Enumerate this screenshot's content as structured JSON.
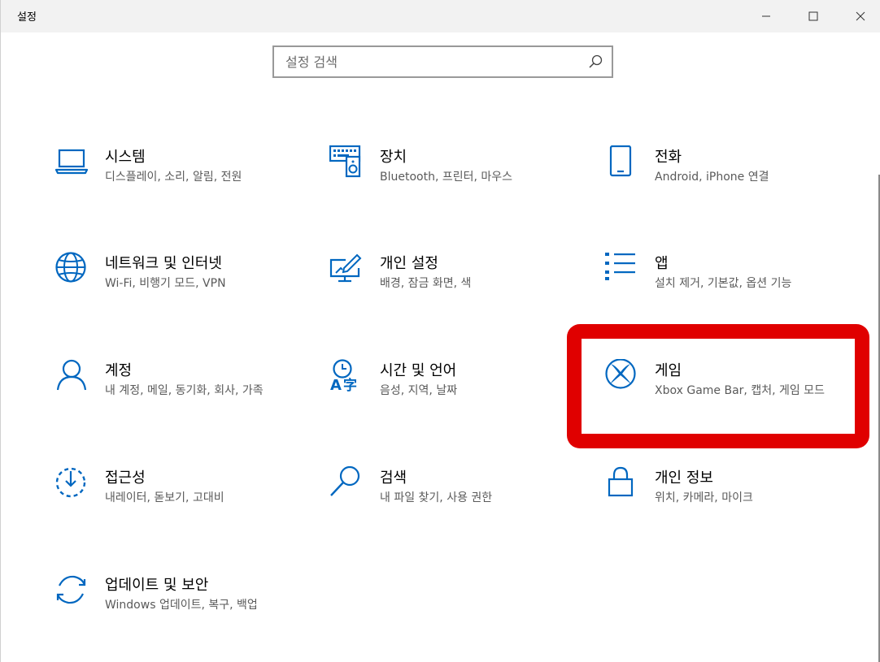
{
  "window": {
    "title": "설정"
  },
  "search": {
    "placeholder": "설정 검색",
    "value": ""
  },
  "colors": {
    "accent": "#0067c0",
    "highlight": "#e00000",
    "title_bar": "#f2f2f2"
  },
  "tiles": [
    {
      "name": "시스템",
      "desc": "디스플레이, 소리, 알림, 전원",
      "icon": "laptop-icon"
    },
    {
      "name": "장치",
      "desc": "Bluetooth, 프린터, 마우스",
      "icon": "devices-icon"
    },
    {
      "name": "전화",
      "desc": "Android, iPhone 연결",
      "icon": "phone-icon"
    },
    {
      "name": "네트워크 및 인터넷",
      "desc": "Wi-Fi, 비행기 모드, VPN",
      "icon": "globe-icon"
    },
    {
      "name": "개인 설정",
      "desc": "배경, 잠금 화면, 색",
      "icon": "personalization-icon"
    },
    {
      "name": "앱",
      "desc": "설치 제거, 기본값, 옵션 기능",
      "icon": "apps-list-icon"
    },
    {
      "name": "계정",
      "desc": "내 계정, 메일, 동기화, 회사, 가족",
      "icon": "person-icon"
    },
    {
      "name": "시간 및 언어",
      "desc": "음성, 지역, 날짜",
      "icon": "time-language-icon"
    },
    {
      "name": "게임",
      "desc": "Xbox Game Bar, 캡처, 게임 모드",
      "icon": "xbox-icon"
    },
    {
      "name": "접근성",
      "desc": "내레이터, 돋보기, 고대비",
      "icon": "ease-of-access-icon"
    },
    {
      "name": "검색",
      "desc": "내 파일 찾기, 사용 권한",
      "icon": "search-magnifier-icon"
    },
    {
      "name": "개인 정보",
      "desc": "위치, 카메라, 마이크",
      "icon": "lock-icon"
    },
    {
      "name": "업데이트 및 보안",
      "desc": "Windows 업데이트, 복구, 백업",
      "icon": "sync-icon"
    }
  ]
}
